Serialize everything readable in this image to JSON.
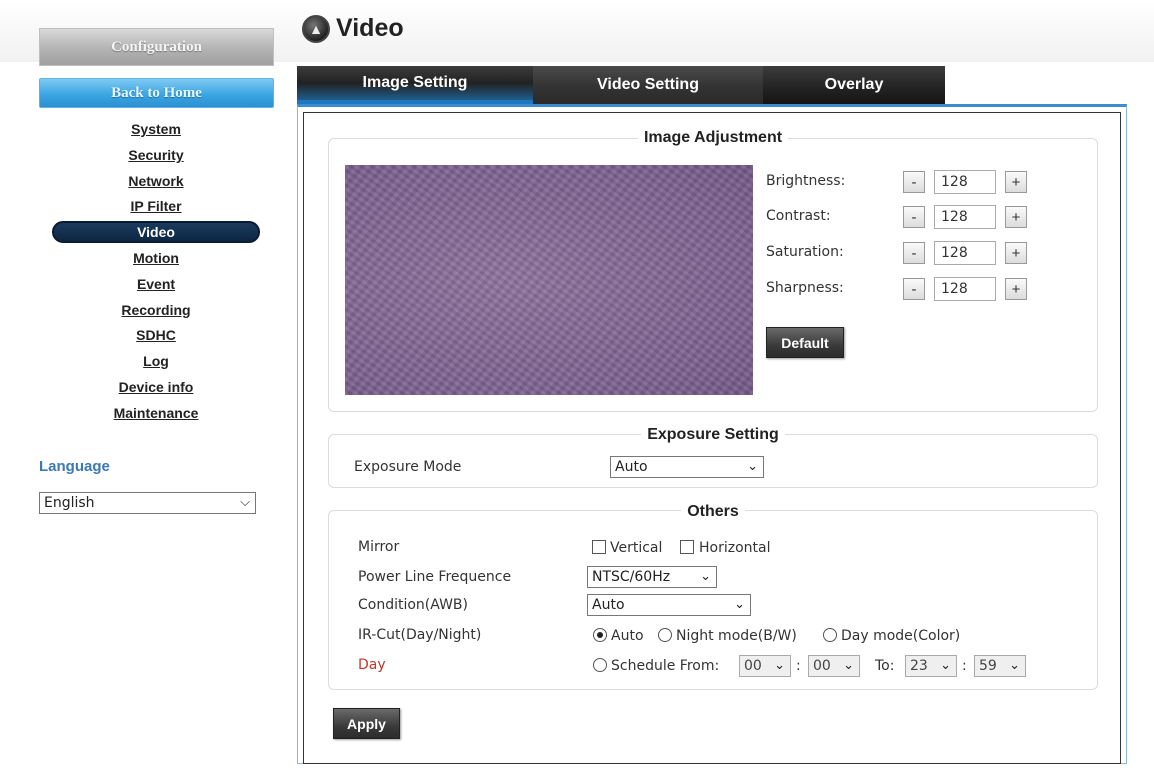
{
  "sidebar": {
    "config_label": "Configuration",
    "home_label": "Back to Home",
    "items": [
      {
        "label": "System"
      },
      {
        "label": "Security"
      },
      {
        "label": "Network"
      },
      {
        "label": "IP Filter"
      },
      {
        "label": "Video"
      },
      {
        "label": "Motion"
      },
      {
        "label": "Event"
      },
      {
        "label": "Recording"
      },
      {
        "label": "SDHC"
      },
      {
        "label": "Log"
      },
      {
        "label": "Device info"
      },
      {
        "label": "Maintenance"
      }
    ],
    "active_item": "Video",
    "language_label": "Language",
    "language_value": "English"
  },
  "header": {
    "title": "Video"
  },
  "tabs": [
    {
      "label": "Image Setting",
      "active": true
    },
    {
      "label": "Video Setting",
      "active": false
    },
    {
      "label": "Overlay",
      "active": false
    }
  ],
  "image_adjustment": {
    "title": "Image Adjustment",
    "controls": [
      {
        "label": "Brightness:",
        "value": "128",
        "minus": "-",
        "plus": "+"
      },
      {
        "label": "Contrast:",
        "value": "128",
        "minus": "-",
        "plus": "+"
      },
      {
        "label": "Saturation:",
        "value": "128",
        "minus": "-",
        "plus": "+"
      },
      {
        "label": "Sharpness:",
        "value": "128",
        "minus": "-",
        "plus": "+"
      }
    ],
    "default_label": "Default"
  },
  "exposure": {
    "title": "Exposure Setting",
    "mode_label": "Exposure Mode",
    "mode_value": "Auto"
  },
  "others": {
    "title": "Others",
    "mirror_label": "Mirror",
    "mirror_vertical": "Vertical",
    "mirror_horizontal": "Horizontal",
    "power_label": "Power Line Frequence",
    "power_value": "NTSC/60Hz",
    "awb_label": "Condition(AWB)",
    "awb_value": "Auto",
    "ircut_label": "IR-Cut(Day/Night)",
    "ircut_auto": "Auto",
    "ircut_night": "Night mode(B/W)",
    "ircut_day": "Day mode(Color)",
    "day_label": "Day",
    "schedule_from": "Schedule From:",
    "from_hour": "00",
    "from_min": "00",
    "to_label": "To:",
    "to_hour": "23",
    "to_min": "59",
    "colon": ":"
  },
  "apply_label": "Apply",
  "colors": {
    "accent_blue": "#3a8cd3",
    "nav_active_bg": "#0d2744",
    "language_label": "#3b78b6",
    "day_label": "#c0392b"
  }
}
